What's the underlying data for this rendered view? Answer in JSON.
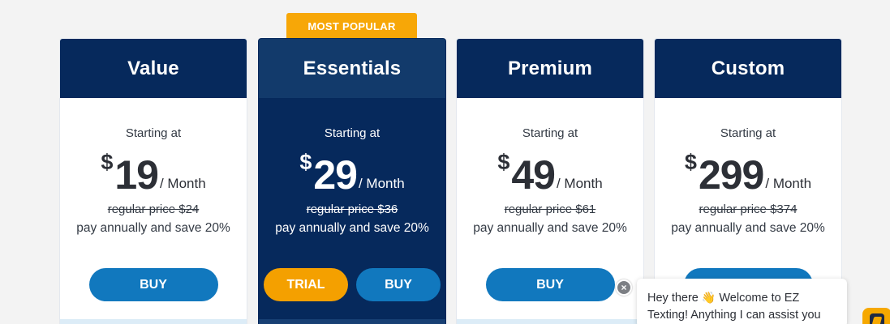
{
  "badge": {
    "label": "MOST POPULAR"
  },
  "plans": [
    {
      "name": "Value",
      "starting": "Starting at",
      "currency": "$",
      "amount": "19",
      "period": "/ Month",
      "regular": "regular price $24",
      "save": "pay annually and save 20%",
      "buy_label": "BUY"
    },
    {
      "name": "Essentials",
      "starting": "Starting at",
      "currency": "$",
      "amount": "29",
      "period": "/ Month",
      "regular": "regular price $36",
      "save": "pay annually and save 20%",
      "trial_label": "TRIAL",
      "buy_label": "BUY"
    },
    {
      "name": "Premium",
      "starting": "Starting at",
      "currency": "$",
      "amount": "49",
      "period": "/ Month",
      "regular": "regular price $61",
      "save": "pay annually and save 20%",
      "buy_label": "BUY"
    },
    {
      "name": "Custom",
      "starting": "Starting at",
      "currency": "$",
      "amount": "299",
      "period": "/ Month",
      "regular": "regular price $374",
      "save": "pay annually and save 20%"
    }
  ],
  "chat": {
    "close_icon": "×",
    "message_start": "Hey there",
    "wave_emoji": "👋",
    "message_rest": "Welcome to EZ Texting! Anything I can assist you",
    "launcher_icon": "chat-launcher-icon"
  },
  "colors": {
    "navy": "#06295c",
    "featured_header": "#123a6b",
    "buy_blue": "#1178be",
    "accent_orange": "#f4a000",
    "page_bg": "#f3f3f3"
  }
}
